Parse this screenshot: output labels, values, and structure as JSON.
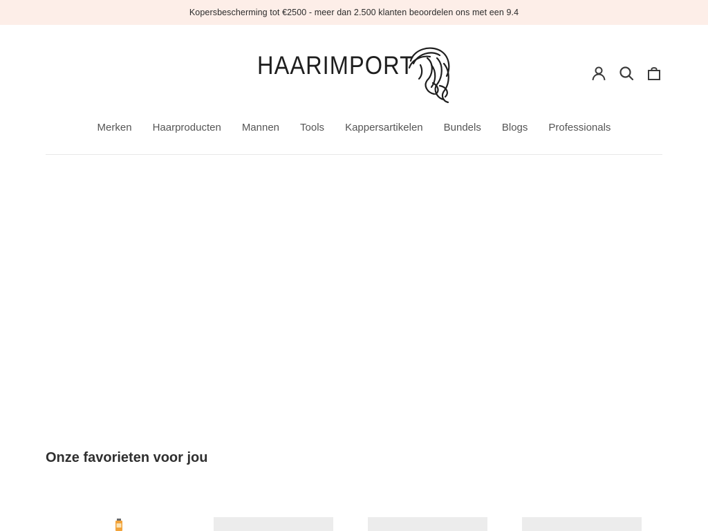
{
  "announcement": {
    "text": "Kopersbescherming tot €2500 - meer dan 2.500 klanten beoordelen ons met een 9.4"
  },
  "header": {
    "logo_text": "HAARIMPORT",
    "icons": {
      "account": "account-icon",
      "search": "search-icon",
      "cart": "cart-icon"
    }
  },
  "nav": {
    "items": [
      {
        "label": "Merken"
      },
      {
        "label": "Haarproducten"
      },
      {
        "label": "Mannen"
      },
      {
        "label": "Tools"
      },
      {
        "label": "Kappersartikelen"
      },
      {
        "label": "Bundels"
      },
      {
        "label": "Blogs"
      },
      {
        "label": "Professionals"
      }
    ]
  },
  "favorites": {
    "title": "Onze favorieten voor jou",
    "product_count_visible": 4
  },
  "colors": {
    "announcement_bg": "#fdeee8",
    "text_dark": "#2b2b2b",
    "nav_text": "#555555",
    "divider": "#e7e7e7"
  }
}
